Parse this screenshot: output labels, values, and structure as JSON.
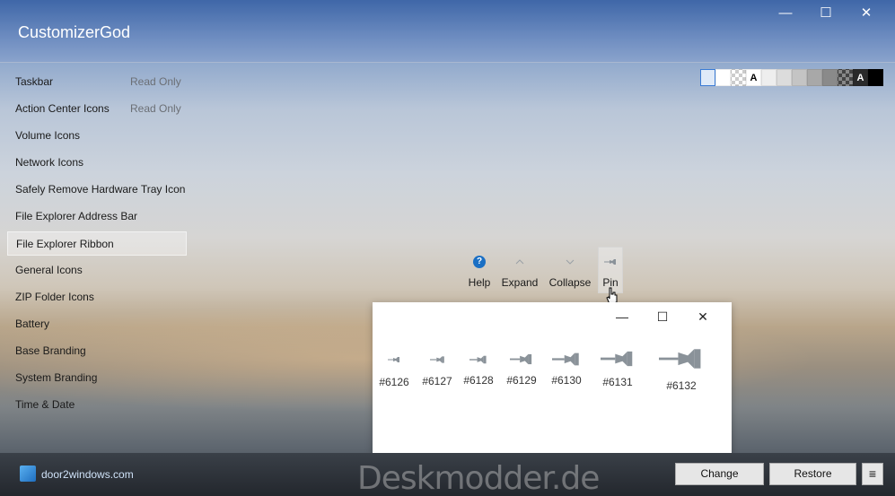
{
  "app": {
    "title": "CustomizerGod",
    "window_controls": {
      "minimize": "—",
      "maximize": "☐",
      "close": "✕"
    }
  },
  "sidebar": {
    "items": [
      {
        "label": "Taskbar",
        "badge": "Read Only"
      },
      {
        "label": "Action Center Icons",
        "badge": "Read Only"
      },
      {
        "label": "Volume Icons",
        "badge": ""
      },
      {
        "label": "Network Icons",
        "badge": ""
      },
      {
        "label": "Safely Remove Hardware Tray Icon",
        "badge": ""
      },
      {
        "label": "File Explorer Address Bar",
        "badge": ""
      },
      {
        "label": "File Explorer Ribbon",
        "badge": "",
        "selected": true
      },
      {
        "label": "General Icons",
        "badge": ""
      },
      {
        "label": "ZIP Folder Icons",
        "badge": ""
      },
      {
        "label": "Battery",
        "badge": ""
      },
      {
        "label": "Base Branding",
        "badge": ""
      },
      {
        "label": "System Branding",
        "badge": ""
      },
      {
        "label": "Time & Date",
        "badge": ""
      }
    ]
  },
  "swatches": {
    "letter": "A",
    "colors": [
      "#dfeaf8",
      "#ffffff",
      "checker",
      "#ffffff",
      "#eeeeee",
      "#dcdcdc",
      "#c4c4c4",
      "#a8a8a8",
      "#8a8a8a",
      "checker-dark",
      "#2a2a2a",
      "#000000"
    ]
  },
  "ribbon": {
    "help_label": "Help",
    "help_glyph": "?",
    "expand_label": "Expand",
    "collapse_label": "Collapse",
    "pin_label": "Pin"
  },
  "popup": {
    "controls": {
      "minimize": "—",
      "maximize": "☐",
      "close": "✕"
    },
    "icons": [
      {
        "id": "#6126",
        "size": 1
      },
      {
        "id": "#6127",
        "size": 2
      },
      {
        "id": "#6128",
        "size": 3
      },
      {
        "id": "#6129",
        "size": 4
      },
      {
        "id": "#6130",
        "size": 5
      },
      {
        "id": "#6131",
        "size": 6
      },
      {
        "id": "#6132",
        "size": 7
      }
    ]
  },
  "bottom": {
    "site": "door2windows.com",
    "watermark": "Deskmodder.de",
    "change_label": "Change",
    "restore_label": "Restore",
    "menu_glyph": "≡"
  },
  "colors": {
    "accent": "#1a6fc4",
    "titlebar": "#4f74b0",
    "pin_icon": "#8a9299"
  }
}
